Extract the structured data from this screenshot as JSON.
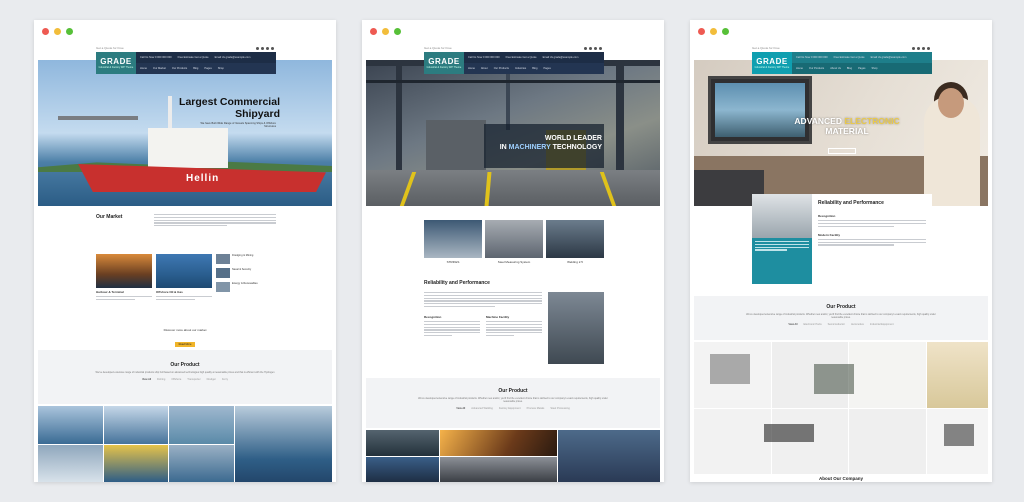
{
  "windows": [
    {
      "id": "marine",
      "topbar_text": "Get a Quote for Free",
      "logo": "GRADE",
      "logo_tagline": "Industrial & Factory WP Theme",
      "header_info": [
        "Call Us Now  0 000 000 000",
        "Free Estimate  Get a Quote",
        "Email Us  grade@example.com"
      ],
      "nav": [
        "Home",
        "Our Market",
        "Our Products",
        "Blog",
        "Pages",
        "Shop",
        "About Us",
        "Contact",
        "Blog"
      ],
      "hero_title": "Largest Commercial Shipyard",
      "hero_sub": "We have Built Wide Range of Vessels Spanning Ships & Offshore Structures",
      "ship_name": "Hellin",
      "market_title": "Our Market",
      "markets": [
        {
          "label": "Harbour & Terminal"
        },
        {
          "label": "Offshore Oil & Gas"
        }
      ],
      "market_list": [
        "Dredging & Mining",
        "Naval & Security",
        "Energy & Renewables"
      ],
      "discover_text": "Discover more about our market",
      "discover_btn": "Read More",
      "product_title": "Our Product",
      "product_desc": "We've developed extensive range of industrial products ship hull based on advanced technologies high quality at reasonable prices and that is efficient with the Hydrogen",
      "tabs": [
        "View All",
        "Fishing",
        "Offshore",
        "Transporter",
        "Dredger",
        "Ferry"
      ]
    },
    {
      "id": "machinery",
      "topbar_text": "Get a Quote for Free",
      "logo": "GRADE",
      "logo_tagline": "Industrial & Factory WP Theme",
      "header_info": [
        "Call Us Now  0 000 000 000",
        "Free Estimate  Get a Quote",
        "Email Us  grade@example.com"
      ],
      "nav": [
        "Home",
        "About",
        "Our Products",
        "Industries",
        "Blog",
        "Pages",
        "Shop",
        "Contact Us"
      ],
      "hero_kicker": "World Leader Machinery",
      "hero_title_1": "WORLD LEADER",
      "hero_title_2a": "IN ",
      "hero_title_2b": "MACHINERY",
      "hero_title_2c": " TECHNOLOGY",
      "tiles": [
        "STRIKES",
        "Steel Measuring System",
        "Welding 2.5"
      ],
      "reliability_title": "Reliability and Performance",
      "cols": [
        "Recognition",
        "Machine Facility"
      ],
      "product_title": "Our Product",
      "product_desc": "We've developed extensive range of industrial products. Whether new and/or, you'll find the excellent choice that is defined to our company's exact requirements, high quality under reasonable prices.",
      "tabs": [
        "View All",
        "Advanced Welding",
        "Factory Equipment",
        "Process Metals",
        "Steel Processing"
      ]
    },
    {
      "id": "electronic",
      "topbar_text": "Get a Quote for Free",
      "logo": "GRADE",
      "logo_tagline": "Industrial & Factory WP Theme",
      "header_info": [
        "Call Us Now  0 000 000 000",
        "Free Estimate  Get a Quote",
        "Email Us  grade@example.com"
      ],
      "nav": [
        "Home",
        "Our Products",
        "About Us",
        "Blog",
        "Pages",
        "Shop",
        "Contact Us",
        "Blog"
      ],
      "hero_title_1a": "ADVANCED ",
      "hero_title_1b": "ELECTRONIC",
      "hero_title_2": "MATERIAL",
      "reliability_title": "Reliability and Performance",
      "sub_1": "Recognition",
      "sub_2": "Modern Facility",
      "product_title": "Our Product",
      "product_desc": "We've developed extensive range of industrial products. Whether new and/or, you'll find the excellent choice that is defined to our company's exact requirements, high quality under reasonable prices.",
      "tabs": [
        "View All",
        "Electronic Parts",
        "Semiconductor",
        "Automotive",
        "Industrial Equipment"
      ],
      "about_title": "About Our Company"
    }
  ]
}
